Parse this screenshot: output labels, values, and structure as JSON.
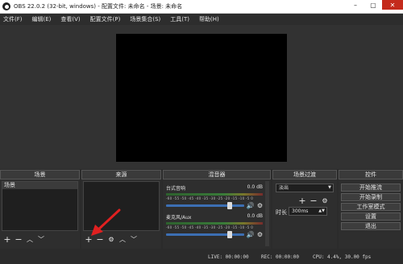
{
  "window": {
    "title": "OBS 22.0.2 (32-bit, windows) - 配置文件: 未命名 - 场景: 未命名"
  },
  "menu": [
    "文件(F)",
    "编辑(E)",
    "查看(V)",
    "配置文件(P)",
    "场景集合(S)",
    "工具(T)",
    "帮助(H)"
  ],
  "docks": {
    "scenes": {
      "title": "场景",
      "items": [
        "场景"
      ]
    },
    "sources": {
      "title": "来源"
    },
    "mixer": {
      "title": "混音器",
      "channels": [
        {
          "name": "台式音响",
          "db": "0.0 dB",
          "level": 0.82
        },
        {
          "name": "麦克风/Aux",
          "db": "0.0 dB",
          "level": 0.82
        }
      ],
      "ticks": "-60 -55 -50 -45 -40 -35 -30 -25 -20 -15 -10 -5 0"
    },
    "transitions": {
      "title": "场景过渡",
      "selected": "淡出",
      "duration_label": "时长",
      "duration_value": "300ms"
    },
    "controls": {
      "title": "控件",
      "buttons": [
        "开始推流",
        "开始录制",
        "工作室模式",
        "设置",
        "退出"
      ]
    }
  },
  "status": {
    "live": "LIVE: 00:00:00",
    "rec": "REC: 00:00:00",
    "cpu": "CPU: 4.4%, 30.00 fps"
  },
  "colors": {
    "accent_slider": "#3c6fb3",
    "annotation_arrow": "#e02020",
    "close_button": "#c42b1c"
  }
}
